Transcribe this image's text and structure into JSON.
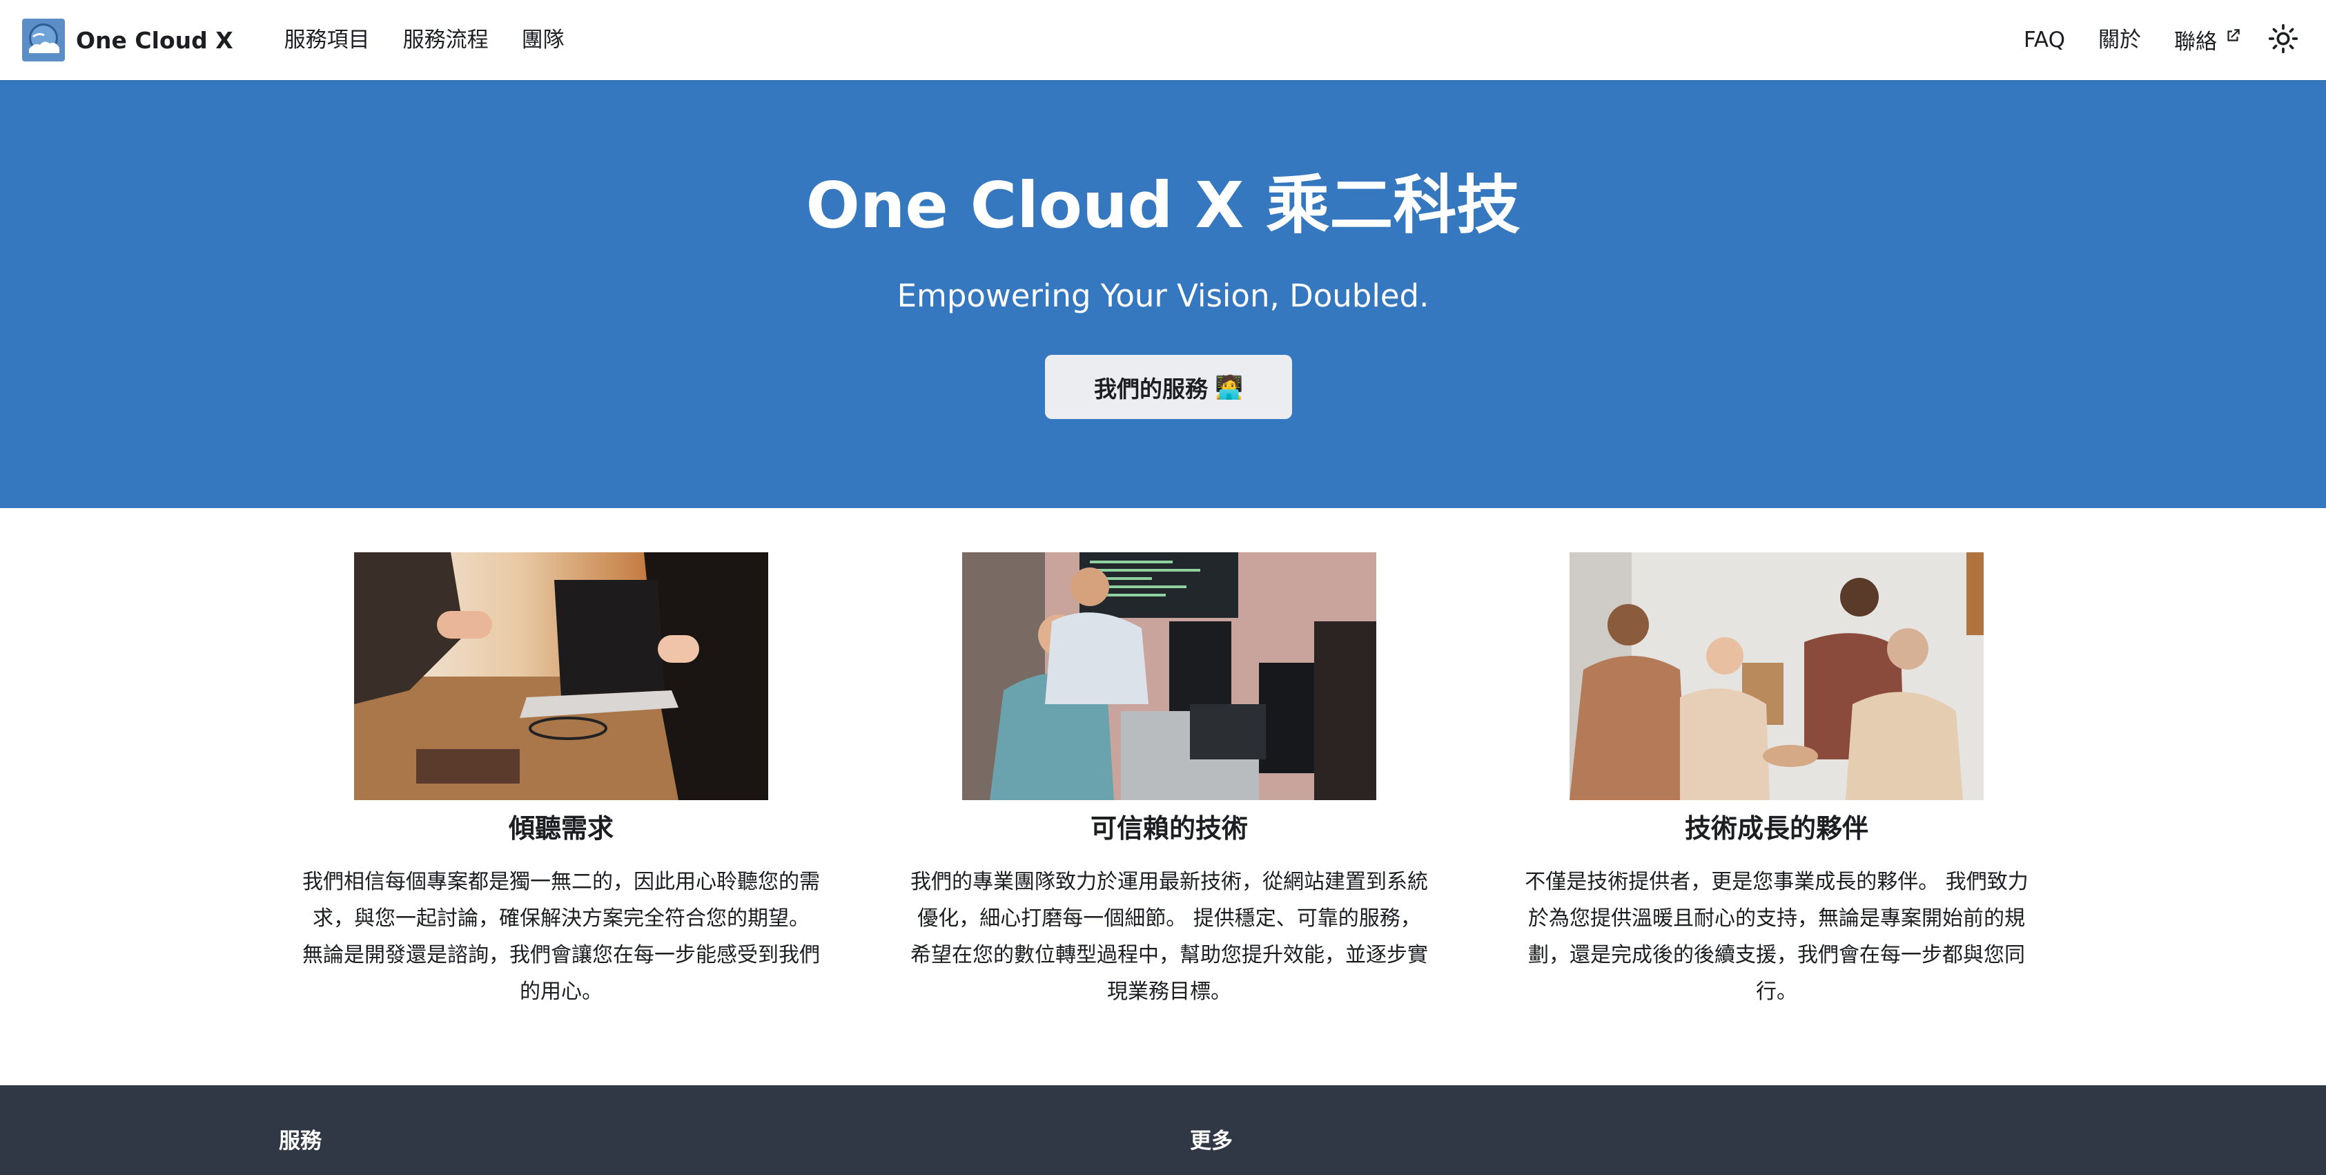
{
  "navbar": {
    "logo_icon": "cloud-logo-icon",
    "brand": "One Cloud X",
    "left_links": [
      "服務項目",
      "服務流程",
      "團隊"
    ],
    "right_links": {
      "faq": "FAQ",
      "about": "關於",
      "contact": "聯絡"
    },
    "external_icon": "external-link-icon",
    "theme_icon": "sun-icon"
  },
  "hero": {
    "title": "One Cloud X 乘二科技",
    "subtitle": "Empowering Your Vision, Doubled.",
    "button_label": "我們的服務",
    "button_emoji": "🧑‍💻",
    "background_color": "#3578c0"
  },
  "features": [
    {
      "title": "傾聽需求",
      "description": "我們相信每個專案都是獨一無二的，因此用心聆聽您的需求，與您一起討論，確保解決方案完全符合您的期望。 無論是開發還是諮詢，我們會讓您在每一步能感受到我們的用心。"
    },
    {
      "title": "可信賴的技術",
      "description": "我們的專業團隊致力於運用最新技術，從網站建置到系統優化，細心打磨每一個細節。 提供穩定、可靠的服務，希望在您的數位轉型過程中，幫助您提升效能，並逐步實現業務目標。"
    },
    {
      "title": "技術成長的夥伴",
      "description": "不僅是技術提供者，更是您事業成長的夥伴。 我們致力於為您提供溫暖且耐心的支持，無論是專案開始前的規劃，還是完成後的後續支援，我們會在每一步都與您同行。"
    }
  ],
  "footer": {
    "col1_title": "服務",
    "col2_title": "更多",
    "background_color": "#303846"
  }
}
